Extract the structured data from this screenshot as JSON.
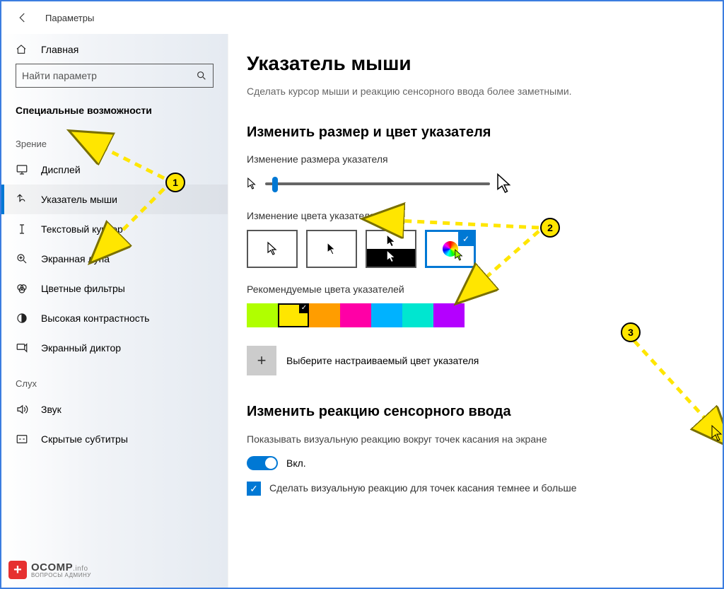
{
  "titlebar": {
    "title": "Параметры"
  },
  "sidebar": {
    "home": "Главная",
    "search_placeholder": "Найти параметр",
    "section_title": "Специальные возможности",
    "vision_header": "Зрение",
    "items_vision": [
      {
        "label": "Дисплей"
      },
      {
        "label": "Указатель мыши"
      },
      {
        "label": "Текстовый курсор"
      },
      {
        "label": "Экранная лупа"
      },
      {
        "label": "Цветные фильтры"
      },
      {
        "label": "Высокая контрастность"
      },
      {
        "label": "Экранный диктор"
      }
    ],
    "hearing_header": "Слух",
    "items_hearing": [
      {
        "label": "Звук"
      },
      {
        "label": "Скрытые субтитры"
      }
    ]
  },
  "content": {
    "h1": "Указатель мыши",
    "subtitle": "Сделать курсор мыши и реакцию сенсорного ввода более заметными.",
    "h2_size_color": "Изменить размер и цвет указателя",
    "label_size": "Изменение размера указателя",
    "label_color": "Изменение цвета указателя",
    "label_recommended": "Рекомендуемые цвета указателей",
    "custom_color": "Выберите настраиваемый цвет указателя",
    "h2_touch": "Изменить реакцию сенсорного ввода",
    "touch_desc": "Показывать визуальную реакцию вокруг точек касания на экране",
    "toggle_on": "Вкл.",
    "checkbox_text": "Сделать визуальную реакцию для точек касания темнее и больше",
    "swatches": [
      "#b0ff00",
      "#ffe600",
      "#ff9d00",
      "#ff00a6",
      "#00b2ff",
      "#00e6d0",
      "#b400ff"
    ],
    "selected_swatch_index": 1
  },
  "annotations": {
    "badges": [
      "1",
      "2",
      "3"
    ]
  },
  "watermark": {
    "brand": "OCOMP",
    "tld": ".info",
    "tagline": "ВОПРОСЫ АДМИНУ"
  }
}
